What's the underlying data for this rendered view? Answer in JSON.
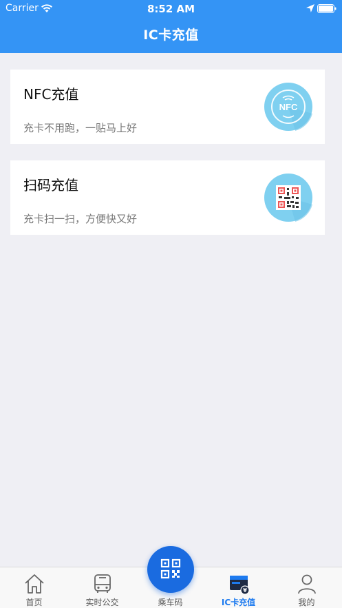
{
  "status_bar": {
    "carrier": "Carrier",
    "time": "8:52 AM"
  },
  "header": {
    "title": "IC卡充值"
  },
  "cards": [
    {
      "title": "NFC充值",
      "subtitle": "充卡不用跑，一贴马上好",
      "icon": "nfc-icon",
      "badge_text": "NFC"
    },
    {
      "title": "扫码充值",
      "subtitle": "充卡扫一扫，方便快又好",
      "icon": "qr-code-icon"
    }
  ],
  "tabbar": {
    "items": [
      {
        "label": "首页",
        "icon": "home-icon"
      },
      {
        "label": "实时公交",
        "icon": "bus-icon"
      },
      {
        "label": "乘车码",
        "icon": "qr-code-icon"
      },
      {
        "label": "IC卡充值",
        "icon": "card-recharge-icon",
        "active": true
      },
      {
        "label": "我的",
        "icon": "profile-icon"
      }
    ]
  },
  "colors": {
    "brand": "#3494f5",
    "active": "#1e7bef",
    "fab": "#1a6be0",
    "icon_circle": "#7fd0f0"
  }
}
